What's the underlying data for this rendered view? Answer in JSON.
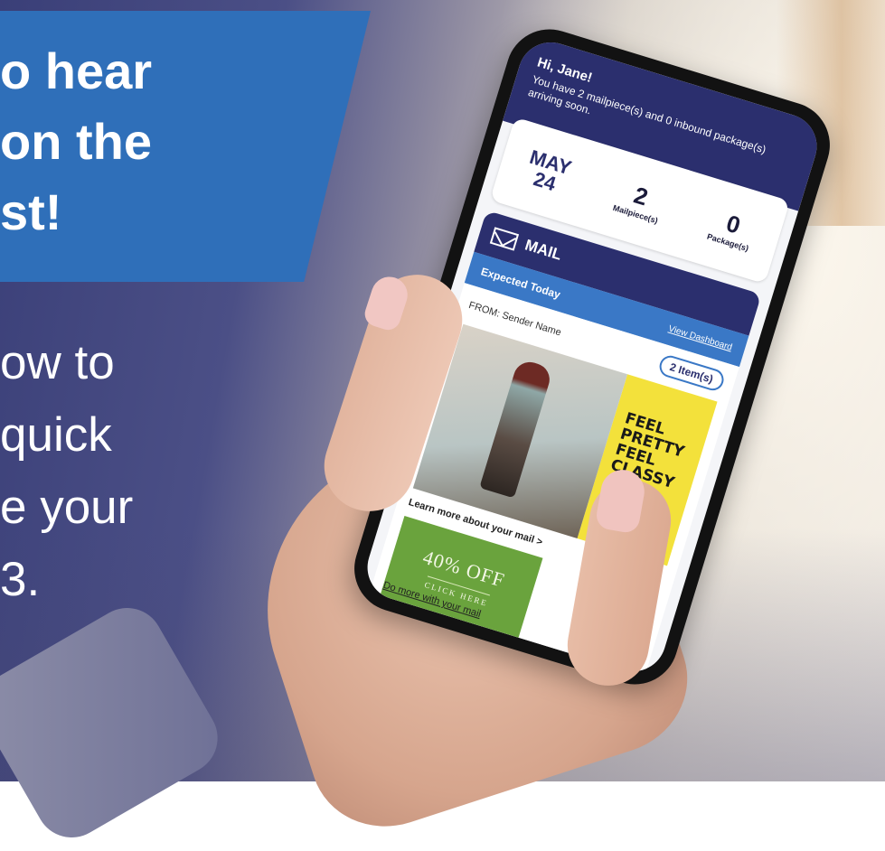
{
  "promo": {
    "headline_lines": [
      "o hear",
      "on the",
      "st!"
    ],
    "body_lines": [
      "ow to",
      "quick",
      "e your",
      "3."
    ]
  },
  "phone_app": {
    "greeting": "Hi, Jane!",
    "summary": "You have 2 mailpiece(s) and 0 inbound package(s) arriving soon.",
    "date_month": "MAY",
    "date_day": "24",
    "mailpieces_count": "2",
    "mailpieces_label": "Mailpiece(s)",
    "packages_count": "0",
    "packages_label": "Package(s)",
    "mail_heading": "MAIL",
    "expected_label": "Expected Today",
    "dashboard_link": "View Dashboard",
    "from_label": "FROM: Sender Name",
    "items_badge": "2 Item(s)",
    "ad_text": "FEEL PRETTY FEEL CLASSY",
    "learn_more": "Learn more about your mail >",
    "coupon_title": "40% OFF",
    "coupon_sub": "CLICK HERE",
    "do_more": "Do more with your mail"
  }
}
